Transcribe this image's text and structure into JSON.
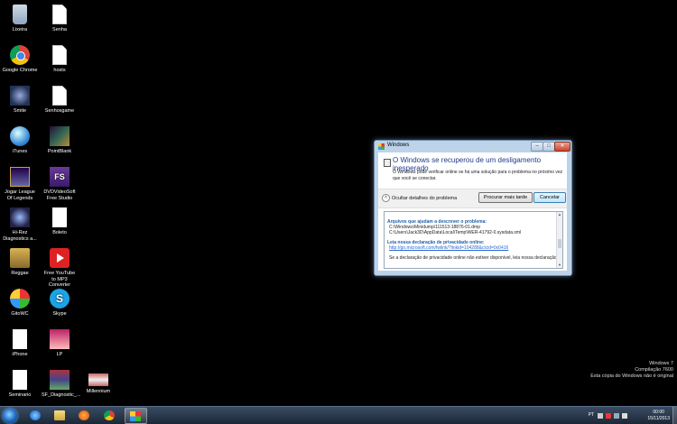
{
  "desktop_icons": [
    {
      "label": "Lixeira",
      "icon": "recycle-bin-icon"
    },
    {
      "label": "Senha",
      "icon": "text-document-icon"
    },
    {
      "label": "Google Chrome",
      "icon": "chrome-icon"
    },
    {
      "label": "hosts",
      "icon": "text-document-icon"
    },
    {
      "label": "Smite",
      "icon": "smite-icon"
    },
    {
      "label": "Senhosgame",
      "icon": "text-document-icon"
    },
    {
      "label": "iTunes",
      "icon": "itunes-icon"
    },
    {
      "label": "PointBlank",
      "icon": "pointblank-icon"
    },
    {
      "label": "Jogar League Of Legends",
      "icon": "league-of-legends-icon"
    },
    {
      "label": "DVDVideoSoft Free Studio",
      "icon": "dvdvideosoft-icon"
    },
    {
      "label": "Hi-Rez Diagnostics a...",
      "icon": "hirez-icon"
    },
    {
      "label": "Boleto",
      "icon": "document-icon"
    },
    {
      "label": "Reggae",
      "icon": "folder-icon"
    },
    {
      "label": "Free YouTube to MP3 Converter",
      "icon": "youtube-mp3-icon"
    },
    {
      "label": "GitoWC",
      "icon": "gitowc-icon"
    },
    {
      "label": "Skype",
      "icon": "skype-icon"
    },
    {
      "label": "iPhone",
      "icon": "document-icon"
    },
    {
      "label": "LP",
      "icon": "image-icon"
    },
    {
      "label": "Seminario",
      "icon": "document-icon"
    },
    {
      "label": "SF_Diagnostic_...",
      "icon": "diagnostic-icon"
    },
    {
      "label": "Millennium",
      "icon": "millennium-icon"
    }
  ],
  "dialog": {
    "window_title": "Windows",
    "heading": "O Windows se recuperou de um desligamento inesperado",
    "description": "O Windows pode verificar online se há uma solução para o problema no próximo vez que você se conectar.",
    "details_toggle": "Ocultar detalhes do problema",
    "primary_button": "Procurar mais tarde",
    "cancel_button": "Cancelar",
    "files_heading": "Arquivos que ajudam a descrever o problema:",
    "files": [
      "C:\\Windows\\Minidump\\111513-18876-01.dmp",
      "C:\\Users\\Jack3D\\AppData\\Local\\Temp\\WER-41792-0.sysdata.xml"
    ],
    "privacy_heading": "Leia nossa declaração de privacidade online:",
    "privacy_link": "http://go.microsoft.com/fwlink/?linkid=104288&clcid=0x0416",
    "privacy_note": "Se a declaração de privacidade online não estiver disponível, leia nossa declaração"
  },
  "watermark": {
    "line1": "Windows 7",
    "line2": "Compilação 7600",
    "line3": "Esta cópia do Windows não é original"
  },
  "taskbar": {
    "apps": [
      "internet-explorer-icon",
      "folder-icon",
      "media-player-icon",
      "chrome-icon",
      "error-report-icon"
    ],
    "language": "PT",
    "time": "00:00",
    "date": "15/11/2013"
  }
}
